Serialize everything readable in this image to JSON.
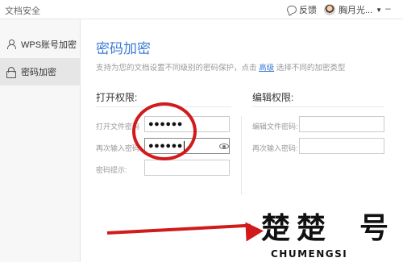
{
  "window": {
    "title": "文档安全",
    "feedback_label": "反馈",
    "user_name": "胸月光..."
  },
  "sidebar": {
    "items": [
      {
        "label": "WPS账号加密",
        "icon": "person-icon",
        "active": false
      },
      {
        "label": "密码加密",
        "icon": "lock-icon",
        "active": true
      }
    ]
  },
  "main": {
    "title": "密码加密",
    "description_before": "支持为您的文档设置不同级别的密码保护，点击",
    "description_link": "高级",
    "description_after": "选择不同的加密类型",
    "open_section": {
      "title": "打开权限:",
      "open_password_label": "打开文件密码",
      "open_password_value": "●●●●●●",
      "confirm_password_label": "再次输入密码",
      "confirm_password_value": "●●●●●●",
      "hint_label": "密码提示:",
      "hint_value": ""
    },
    "edit_section": {
      "title": "编辑权限:",
      "edit_password_label": "编辑文件密码:",
      "edit_password_value": "",
      "confirm_password_label": "再次输入密码:",
      "confirm_password_value": ""
    }
  },
  "annotations": {
    "color": "#d11a1a"
  },
  "watermark": {
    "glyphs": [
      "楚",
      "楚",
      "号"
    ],
    "latin": "CHUMENGSI"
  }
}
